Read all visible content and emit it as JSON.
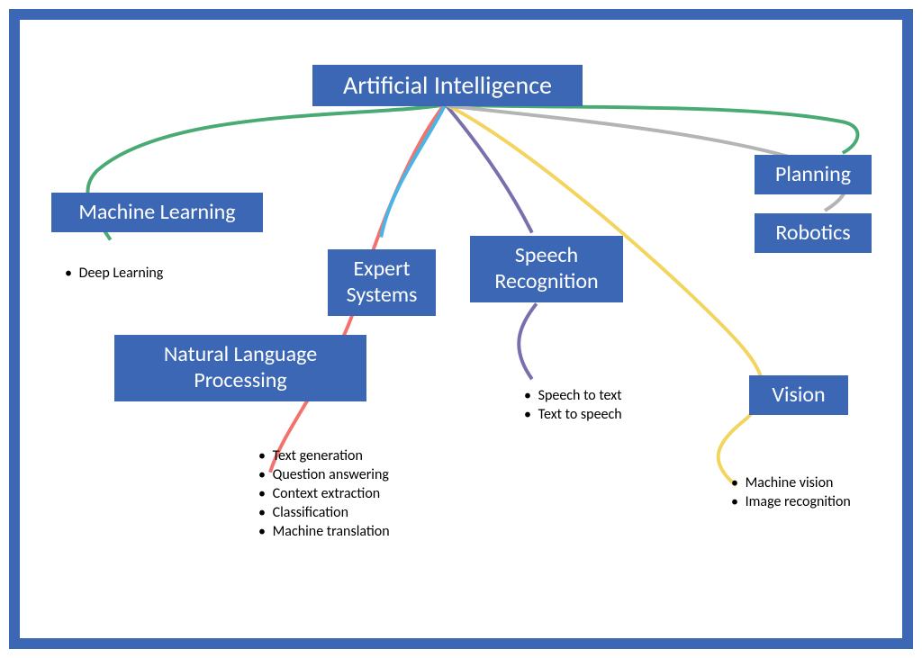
{
  "root": "Artificial Intelligence",
  "branches": {
    "ml": {
      "label": "Machine Learning",
      "color": "#4aaa74",
      "items": [
        "Deep Learning"
      ]
    },
    "nlp": {
      "label": "Natural Language\nProcessing",
      "color": "#f2736d",
      "items": [
        "Text generation",
        "Question answering",
        "Context extraction",
        "Classification",
        "Machine translation"
      ]
    },
    "expert": {
      "label": "Expert\nSystems",
      "color": "#47b6e6",
      "items": []
    },
    "speech": {
      "label": "Speech\nRecognition",
      "color": "#7a6fae",
      "items": [
        "Speech to text",
        "Text to speech"
      ]
    },
    "vision": {
      "label": "Vision",
      "color": "#f3d45e",
      "items": [
        "Machine vision",
        "Image recognition"
      ]
    },
    "planning": {
      "label": "Planning",
      "color": "#4aaa74",
      "items": []
    },
    "robotics": {
      "label": "Robotics",
      "color": "#b3b4b6",
      "items": []
    }
  }
}
